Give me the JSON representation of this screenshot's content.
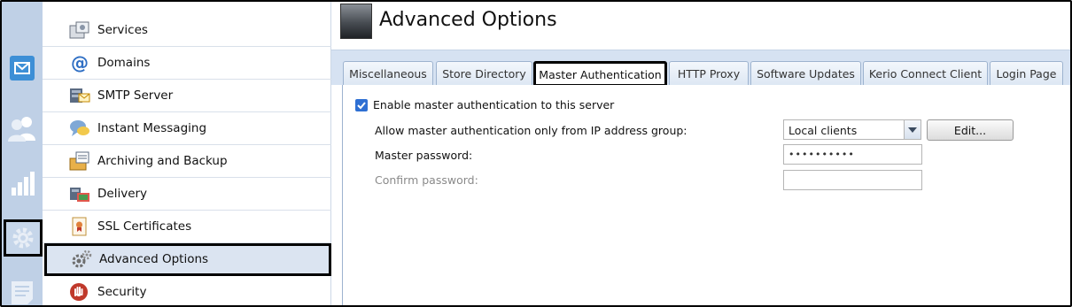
{
  "rail": {
    "items": [
      "mail-icon",
      "users-icon",
      "statistics-icon",
      "configuration-icon",
      "logs-icon"
    ]
  },
  "nav": {
    "items": [
      {
        "label": "Services",
        "icon": "services-icon"
      },
      {
        "label": "Domains",
        "icon": "at-icon"
      },
      {
        "label": "SMTP Server",
        "icon": "smtp-icon"
      },
      {
        "label": "Instant Messaging",
        "icon": "chat-icon"
      },
      {
        "label": "Archiving and Backup",
        "icon": "archive-icon"
      },
      {
        "label": "Delivery",
        "icon": "delivery-icon"
      },
      {
        "label": "SSL Certificates",
        "icon": "certificate-icon"
      },
      {
        "label": "Advanced Options",
        "icon": "gears-icon"
      },
      {
        "label": "Security",
        "icon": "stop-hand-icon"
      }
    ],
    "active_index": 7
  },
  "header": {
    "title": "Advanced Options"
  },
  "tabs": [
    {
      "label": "Miscellaneous"
    },
    {
      "label": "Store Directory"
    },
    {
      "label": "Master Authentication"
    },
    {
      "label": "HTTP Proxy"
    },
    {
      "label": "Software Updates"
    },
    {
      "label": "Kerio Connect Client"
    },
    {
      "label": "Login Page"
    }
  ],
  "active_tab": "Master Authentication",
  "form": {
    "enable_label": "Enable master authentication to this server",
    "enable_checked": true,
    "ip_group_label": "Allow master authentication only from IP address group:",
    "ip_group_value": "Local clients",
    "edit_button": "Edit...",
    "password_label": "Master password:",
    "password_value": "••••••••••",
    "confirm_label": "Confirm password:",
    "confirm_value": ""
  },
  "colors": {
    "rail_bg": "#bfd0e6",
    "tabstrip_bg": "#d6e2f2",
    "checkbox": "#2e6fd3",
    "active_nav_bg": "#dbe4f1"
  }
}
